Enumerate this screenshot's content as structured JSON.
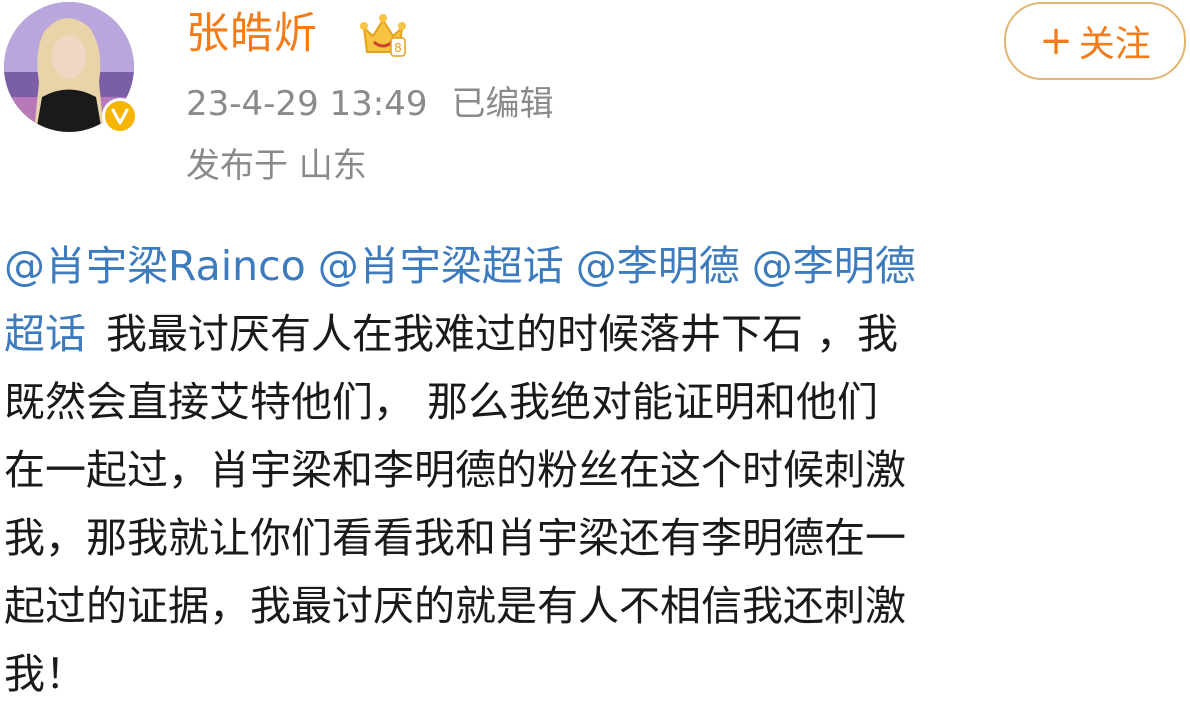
{
  "post": {
    "author": {
      "name": "张皓炘",
      "avatar_icon": "user-avatar",
      "verified_badge": "verified-v-badge",
      "member_icon": "crown-member-icon"
    },
    "time": "23-4-29 13:49",
    "edited": "已编辑",
    "location": "发布于 山东",
    "follow_button": {
      "plus": "+",
      "label": "关注"
    },
    "mentions": {
      "m1": "@肖宇梁Rainco",
      "m2": "@肖宇梁超话",
      "m3": "@李明德",
      "m4_line1": "@李明德",
      "m4_line2": "超话"
    },
    "text": {
      "l2": "我最讨厌有人在我难过的时候落井下石 ，我",
      "l3": "既然会直接艾特他们，  那么我绝对能证明和他们",
      "l4": "在一起过，肖宇梁和李明德的粉丝在这个时候刺激",
      "l5": "我，那我就让你们看看我和肖宇梁还有李明德在一",
      "l6": "起过的证据，我最讨厌的就是有人不相信我还刺激",
      "l7": "我！"
    }
  },
  "colors": {
    "username": "#f37c18",
    "mention": "#3d7bbf",
    "meta": "#8a8a8a",
    "follow_border": "#e3b572",
    "verified": "#f5b400"
  }
}
